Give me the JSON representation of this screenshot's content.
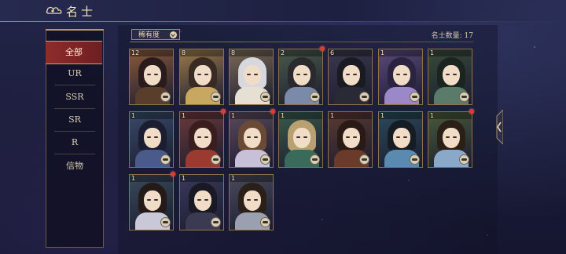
{
  "header": {
    "title": "名士"
  },
  "menu": {
    "items": [
      {
        "label": "全部",
        "active": true
      },
      {
        "label": "UR",
        "active": false
      },
      {
        "label": "SSR",
        "active": false
      },
      {
        "label": "SR",
        "active": false
      },
      {
        "label": "R",
        "active": false
      },
      {
        "label": "信物",
        "active": false
      }
    ]
  },
  "filter": {
    "label": "稀有度"
  },
  "summary": {
    "count_label": "名士数量: 17"
  },
  "colors": {
    "accent_gold": "#a58b55",
    "active_tab": "#8f2b2b",
    "notification": "#e33a30"
  },
  "cards": [
    {
      "level": "12",
      "bg": "#8a5a3a",
      "hair": "#2a1c1c",
      "robe": "#5a3e2c",
      "alert": false
    },
    {
      "level": "8",
      "bg": "#9a7a4a",
      "hair": "#3a2a24",
      "robe": "#c8a860",
      "alert": false
    },
    {
      "level": "8",
      "bg": "#7a6a56",
      "hair": "#d6d8de",
      "robe": "#e6e0d4",
      "alert": false
    },
    {
      "level": "2",
      "bg": "#4a5a4a",
      "hair": "#2a2a2e",
      "robe": "#7a8aa8",
      "alert": true
    },
    {
      "level": "6",
      "bg": "#3a3a4e",
      "hair": "#1a1a22",
      "robe": "#2a2a36",
      "alert": false
    },
    {
      "level": "1",
      "bg": "#5a4a7a",
      "hair": "#2a2440",
      "robe": "#9a88c8",
      "alert": false
    },
    {
      "level": "1",
      "bg": "#3a4a3a",
      "hair": "#1a2420",
      "robe": "#5a7a6a",
      "alert": false
    },
    {
      "level": "1",
      "bg": "#3a4a6a",
      "hair": "#1a1e30",
      "robe": "#4a5a8a",
      "alert": false
    },
    {
      "level": "1",
      "bg": "#6a3a3a",
      "hair": "#3a1e1e",
      "robe": "#9a3a30",
      "alert": true
    },
    {
      "level": "1",
      "bg": "#5a4a5a",
      "hair": "#6a4a34",
      "robe": "#c8c0d8",
      "alert": true
    },
    {
      "level": "1",
      "bg": "#3a5a4a",
      "hair": "#b8a070",
      "robe": "#3a6a5a",
      "alert": false
    },
    {
      "level": "1",
      "bg": "#5a3a30",
      "hair": "#2a1a16",
      "robe": "#6a3a2a",
      "alert": false
    },
    {
      "level": "1",
      "bg": "#2a4a5a",
      "hair": "#161c24",
      "robe": "#5a8ab0",
      "alert": false
    },
    {
      "level": "1",
      "bg": "#4a5a3a",
      "hair": "#2a2018",
      "robe": "#8aa8c8",
      "alert": true
    },
    {
      "level": "1",
      "bg": "#3a4a5a",
      "hair": "#241a18",
      "robe": "#c8c8d8",
      "alert": true
    },
    {
      "level": "1",
      "bg": "#3a3a5a",
      "hair": "#1a1822",
      "robe": "#3a3a52",
      "alert": false
    },
    {
      "level": "1",
      "bg": "#4a4a5a",
      "hair": "#2a2018",
      "robe": "#9aa0b0",
      "alert": false
    }
  ]
}
